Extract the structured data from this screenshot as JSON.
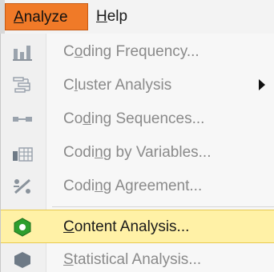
{
  "menubar": {
    "analyze": {
      "pre": "",
      "accel": "A",
      "post": "nalyze"
    },
    "help": {
      "pre": "",
      "accel": "H",
      "post": "elp"
    }
  },
  "menu": {
    "items": [
      {
        "pre": "C",
        "accel": "o",
        "post": "ding Frequency...",
        "icon": "bar-chart-icon",
        "enabled": false
      },
      {
        "pre": "C",
        "accel": "l",
        "post": "uster Analysis",
        "icon": "cluster-tree-icon",
        "enabled": false,
        "submenu": true
      },
      {
        "pre": "Co",
        "accel": "d",
        "post": "ing Sequences...",
        "icon": "sequence-icon",
        "enabled": false
      },
      {
        "pre": "Codi",
        "accel": "n",
        "post": "g by Variables...",
        "icon": "table-variables-icon",
        "enabled": false
      },
      {
        "pre": "Codi",
        "accel": "n",
        "post": "g Agreement...",
        "icon": "agreement-icon",
        "enabled": false
      },
      {
        "pre": "",
        "accel": "C",
        "post": "ontent Analysis...",
        "icon": "content-analysis-icon",
        "enabled": true,
        "highlighted": true
      },
      {
        "pre": "",
        "accel": "S",
        "post": "tatistical Analysis...",
        "icon": "statistics-icon",
        "enabled": false
      }
    ]
  },
  "colors": {
    "active_menu": "#f07a28",
    "highlight": "#fff1a6",
    "disabled_text": "#8a8a8a",
    "enabled_text": "#1a1a1a"
  }
}
